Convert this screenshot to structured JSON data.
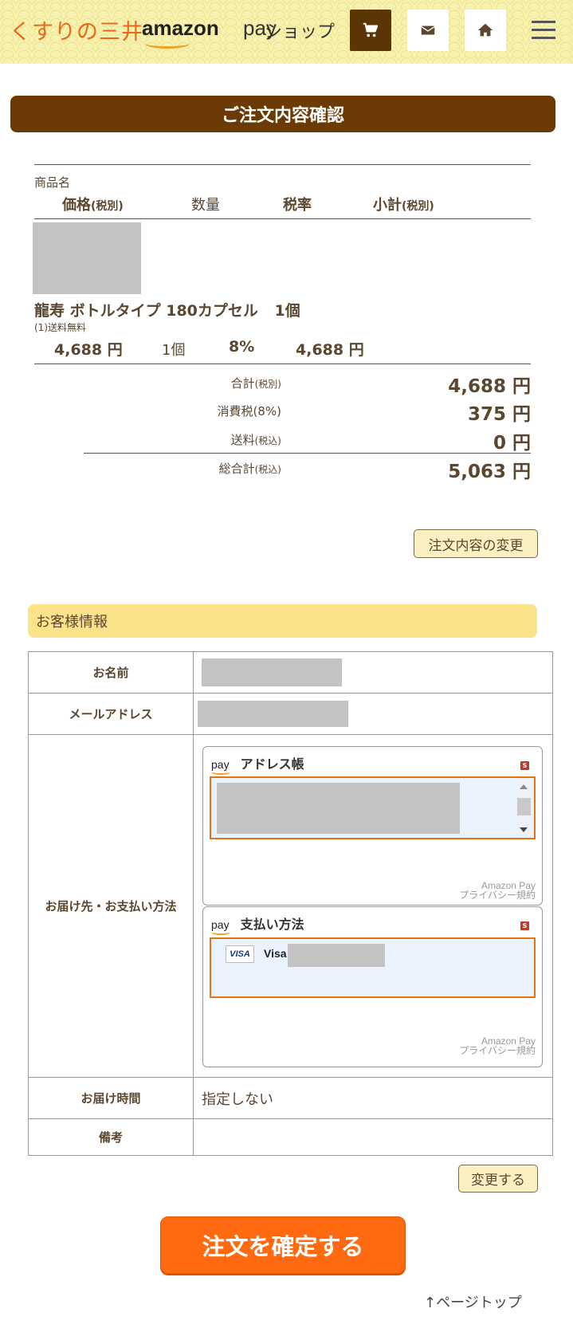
{
  "header": {
    "logo_kusuri": "くすりの三井",
    "logo_amazon": "amazon",
    "logo_pay": "pay",
    "logo_shop": "ショップ",
    "icons": {
      "cart": "cart-icon",
      "mail": "mail-icon",
      "home": "home-icon",
      "menu": "hamburger-menu-icon"
    },
    "colors": {
      "cart_bg": "#5c3506",
      "accent": "#e8691a"
    }
  },
  "order": {
    "title": "ご注文内容確認",
    "columns": {
      "product_name": "商品名",
      "price": "価格",
      "price_note": "(税別)",
      "quantity": "数量",
      "tax_rate": "税率",
      "subtotal": "小計",
      "subtotal_note": "(税別)"
    },
    "item": {
      "name": "龍寿 ボトルタイプ 180カプセル",
      "qty_inline": "1個",
      "shipping_note": "(1)送料無料",
      "price": "4,688 円",
      "qty": "1個",
      "tax_rate": "8%",
      "subtotal": "4,688 円"
    },
    "totals": [
      {
        "label": "合計",
        "note": "(税別)",
        "value": "4,688 円"
      },
      {
        "label": "消費税(8%)",
        "note": "",
        "value": "375 円"
      },
      {
        "label": "送料",
        "note": "(税込)",
        "value": "0 円"
      },
      {
        "label": "総合計",
        "note": "(税込)",
        "value": "5,063 円"
      }
    ],
    "change_button": "注文内容の変更"
  },
  "customer": {
    "title": "お客様情報",
    "rows": {
      "name": "お名前",
      "email": "メールアドレス",
      "delivery_payment": "お届け先・お支払い方法",
      "delivery_time": "お届け時間",
      "delivery_time_value": "指定しない",
      "notes": "備考"
    },
    "address_widget": {
      "pay_label": "pay",
      "title": "アドレス帳",
      "footer_1": "Amazon Pay",
      "footer_2": "プライバシー規約"
    },
    "payment_widget": {
      "pay_label": "pay",
      "title": "支払い方法",
      "card_brand_badge": "VISA",
      "card_name": "Visa",
      "footer_1": "Amazon Pay",
      "footer_2": "プライバシー規約"
    },
    "change_button": "変更する"
  },
  "actions": {
    "confirm_button": "注文を確定する",
    "page_top": "↑ページトップ"
  }
}
